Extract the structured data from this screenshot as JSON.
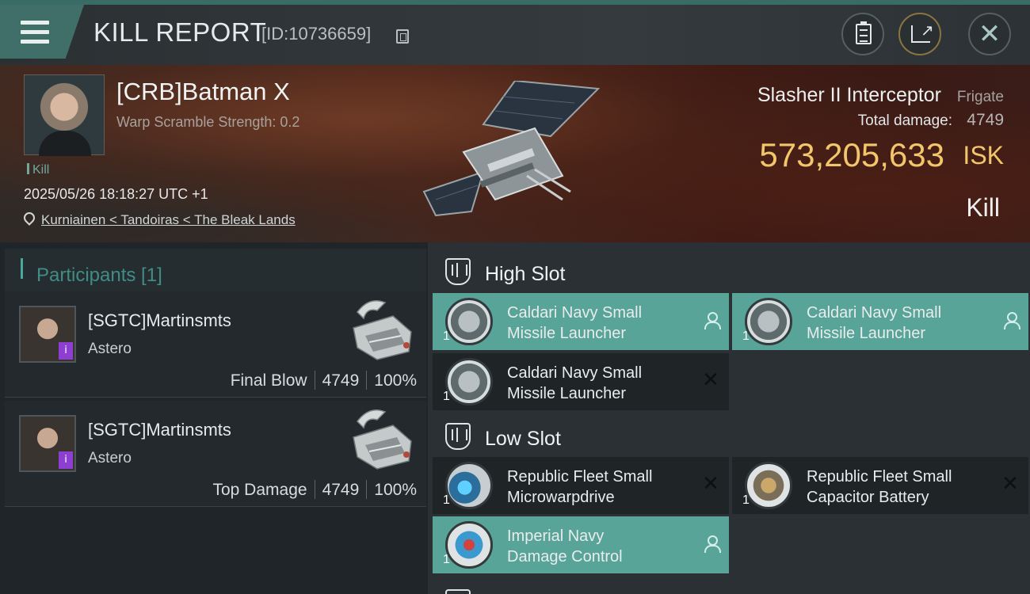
{
  "header": {
    "title": "KILL REPORT",
    "report_id": "[ID:10736659]"
  },
  "victim": {
    "name": "[CRB]Batman X",
    "scramble": "Warp Scramble Strength: 0.2",
    "tag": "Kill",
    "datetime": "2025/05/26 18:18:27 UTC +1",
    "location": "Kurniainen < Tandoiras < The Bleak Lands",
    "ship_name": "Slasher II Interceptor",
    "ship_class": "Frigate",
    "damage_label": "Total damage:",
    "damage_value": "4749",
    "isk_value": "573,205,633",
    "isk_unit": "ISK",
    "result": "Kill"
  },
  "participants": {
    "title": "Participants [1]",
    "rows": [
      {
        "name": "[SGTC]Martinsmts",
        "ship": "Astero",
        "label": "Final Blow",
        "damage": "4749",
        "percent": "100%"
      },
      {
        "name": "[SGTC]Martinsmts",
        "ship": "Astero",
        "label": "Top Damage",
        "damage": "4749",
        "percent": "100%"
      }
    ]
  },
  "slots": {
    "high": {
      "title": "High Slot",
      "modules": [
        {
          "line1": "Caldari Navy Small",
          "line2": "Missile Launcher",
          "qty": "1",
          "status": "dropped"
        },
        {
          "line1": "Caldari Navy Small",
          "line2": "Missile Launcher",
          "qty": "1",
          "status": "dropped"
        },
        {
          "line1": "Caldari Navy Small",
          "line2": "Missile Launcher",
          "qty": "1",
          "status": "destroyed"
        }
      ]
    },
    "low": {
      "title": "Low Slot",
      "modules": [
        {
          "line1": "Republic Fleet Small",
          "line2": "Microwarpdrive",
          "qty": "1",
          "status": "destroyed"
        },
        {
          "line1": "Republic Fleet Small",
          "line2": "Capacitor Battery",
          "qty": "1",
          "status": "destroyed"
        },
        {
          "line1": "Imperial Navy",
          "line2": "Damage Control",
          "qty": "1",
          "status": "dropped"
        }
      ]
    }
  },
  "icons": {
    "menu": "menu-icon",
    "copy": "copy-icon",
    "clipboard": "clipboard-icon",
    "share": "share-icon",
    "close": "close-icon",
    "location": "location-pin-icon",
    "slot": "slot-icon",
    "pilot_badge": "pilot-badge-icon",
    "dropped": "person-icon",
    "destroyed": "x-icon"
  },
  "colors": {
    "accent": "#4aa79c",
    "isk": "#f2c66b",
    "dropped_bg": "#58a498",
    "destroyed_bg": "#1f2427",
    "badge": "#8c3fd1"
  }
}
